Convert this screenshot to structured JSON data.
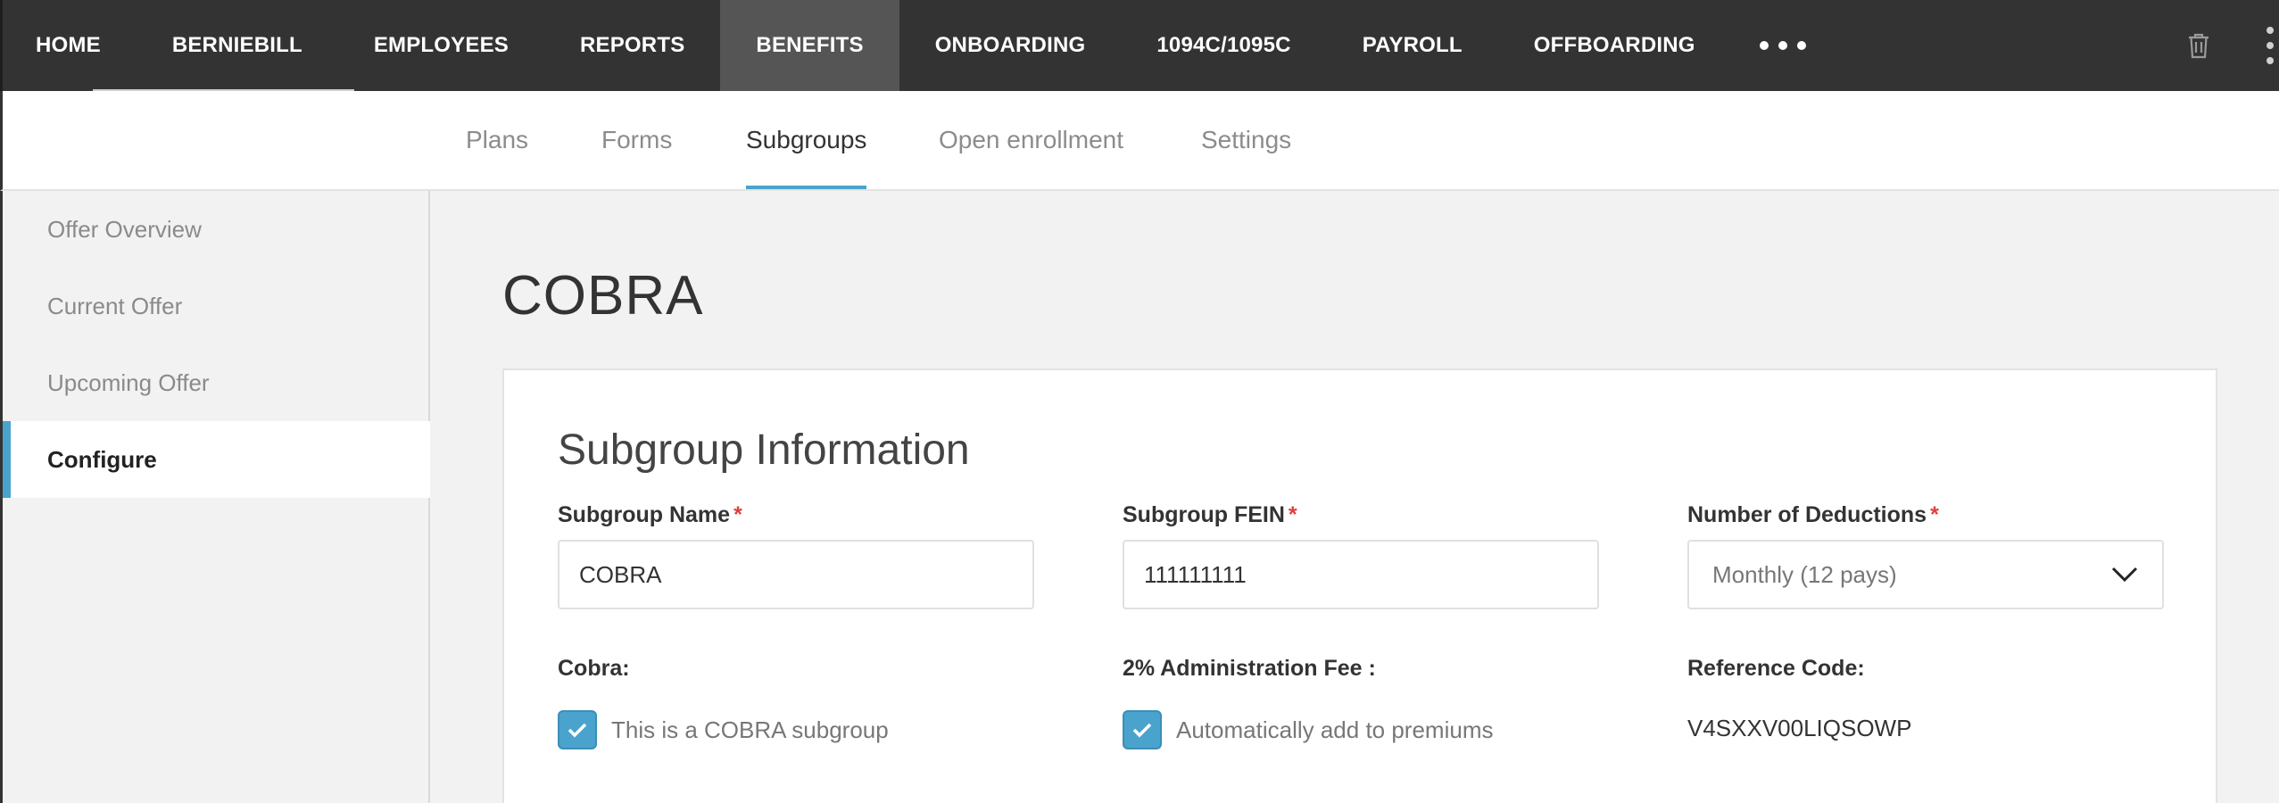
{
  "topnav": {
    "items": [
      {
        "label": "HOME"
      },
      {
        "label": "BERNIEBILL"
      },
      {
        "label": "EMPLOYEES"
      },
      {
        "label": "REPORTS"
      },
      {
        "label": "BENEFITS",
        "active": true
      },
      {
        "label": "ONBOARDING"
      },
      {
        "label": "1094C/1095C"
      },
      {
        "label": "PAYROLL"
      },
      {
        "label": "OFFBOARDING"
      }
    ],
    "more_icon": "more-horizontal-icon",
    "trash_icon": "trash-icon",
    "kebab_icon": "more-vertical-icon"
  },
  "subtabs": [
    {
      "label": "Plans"
    },
    {
      "label": "Forms"
    },
    {
      "label": "Subgroups",
      "active": true
    },
    {
      "label": "Open enrollment"
    },
    {
      "label": "Settings"
    }
  ],
  "sidebar": {
    "items": [
      {
        "label": "Offer Overview"
      },
      {
        "label": "Current Offer"
      },
      {
        "label": "Upcoming Offer"
      },
      {
        "label": "Configure",
        "active": true
      }
    ]
  },
  "page": {
    "title": "COBRA"
  },
  "card": {
    "title": "Subgroup Information",
    "fields": {
      "name": {
        "label": "Subgroup Name",
        "required": "*",
        "value": "COBRA"
      },
      "fein": {
        "label": "Subgroup FEIN",
        "required": "*",
        "value": "111111111"
      },
      "deductions": {
        "label": "Number of Deductions",
        "required": "*",
        "value": "Monthly (12 pays)"
      }
    },
    "cobra": {
      "label": "Cobra:",
      "checkbox_text": "This is a COBRA subgroup",
      "checked": true
    },
    "admin_fee": {
      "label": "2% Administration Fee :",
      "checkbox_text": "Automatically add to premiums",
      "checked": true
    },
    "reference": {
      "label": "Reference Code:",
      "value": "V4SXXV00LIQSOWP"
    }
  },
  "colors": {
    "nav_bg": "#333333",
    "nav_active": "#555555",
    "accent": "#4aa3cc",
    "required": "#e0403a"
  }
}
